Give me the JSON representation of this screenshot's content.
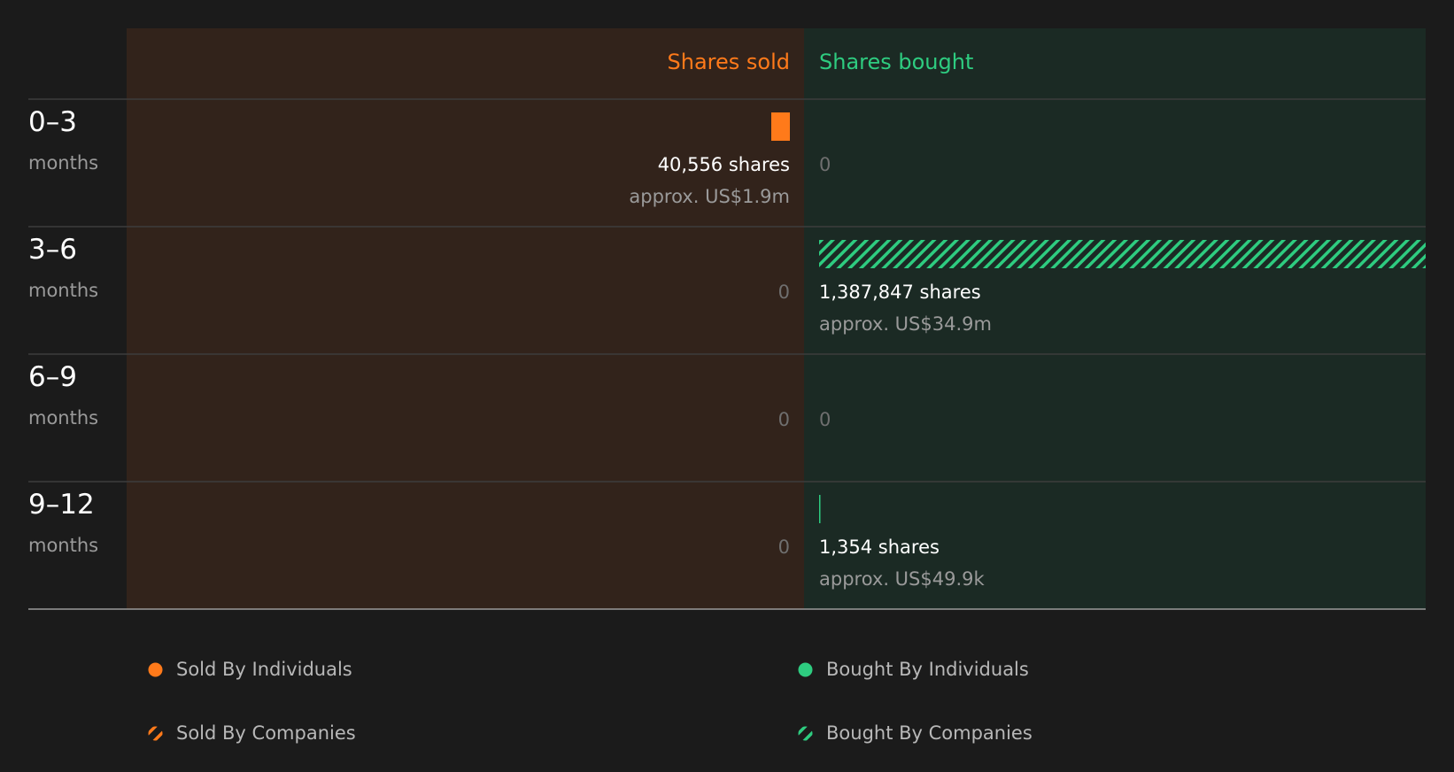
{
  "chart_data": {
    "type": "bar",
    "layout": "diverging-horizontal",
    "sides": {
      "sold": {
        "title": "Shares sold",
        "color": "#ff7a1a",
        "background": "#32231b"
      },
      "bought": {
        "title": "Shares bought",
        "color": "#2ecc80",
        "background": "#1b2a24"
      }
    },
    "rows": [
      {
        "period": "0–3",
        "unit": "months",
        "sold": {
          "shares": 40556,
          "label": "40,556 shares",
          "value": "approx. US$1.9m",
          "by": "individuals"
        },
        "bought": {
          "shares": 0,
          "label": "0",
          "value": ""
        }
      },
      {
        "period": "3–6",
        "unit": "months",
        "sold": {
          "shares": 0,
          "label": "0",
          "value": ""
        },
        "bought": {
          "shares": 1387847,
          "label": "1,387,847 shares",
          "value": "approx. US$34.9m",
          "by": "companies"
        }
      },
      {
        "period": "6–9",
        "unit": "months",
        "sold": {
          "shares": 0,
          "label": "0",
          "value": ""
        },
        "bought": {
          "shares": 0,
          "label": "0",
          "value": ""
        }
      },
      {
        "period": "9–12",
        "unit": "months",
        "sold": {
          "shares": 0,
          "label": "0",
          "value": ""
        },
        "bought": {
          "shares": 1354,
          "label": "1,354 shares",
          "value": "approx. US$49.9k",
          "by": "individuals"
        }
      }
    ],
    "max_shares": 1387847
  },
  "legend": [
    {
      "label": "Sold By Individuals",
      "kind": "dot",
      "color": "#ff7a1a"
    },
    {
      "label": "Bought By Individuals",
      "kind": "dot",
      "color": "#2ecc80"
    },
    {
      "label": "Sold By Companies",
      "kind": "hatch",
      "color": "#ff7a1a"
    },
    {
      "label": "Bought By Companies",
      "kind": "hatch",
      "color": "#2ecc80"
    }
  ]
}
